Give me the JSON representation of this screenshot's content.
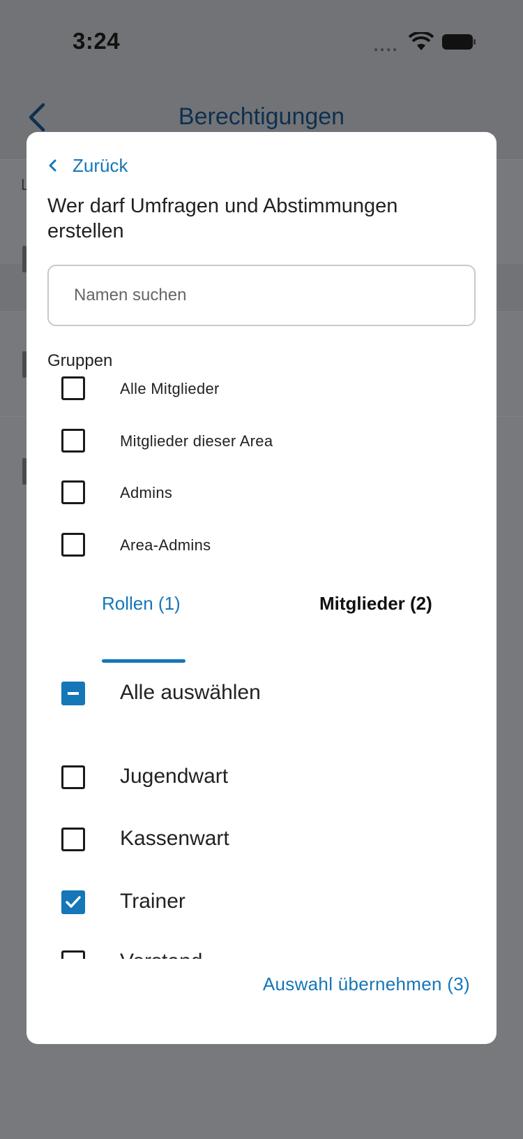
{
  "status_bar": {
    "time": "3:24"
  },
  "nav": {
    "title": "Berechtigungen",
    "bg_letter": "L"
  },
  "modal": {
    "back_label": "Zurück",
    "title": "Wer darf Umfragen und Abstimmungen erstellen",
    "search": {
      "placeholder": "Namen suchen",
      "value": ""
    },
    "groups_label": "Gruppen",
    "groups": [
      {
        "label": "Alle Mitglieder",
        "checked": false
      },
      {
        "label": "Mitglieder dieser Area",
        "checked": false
      },
      {
        "label": "Admins",
        "checked": false
      },
      {
        "label": "Area-Admins",
        "checked": false
      }
    ],
    "tabs": [
      {
        "label": "Rollen (1)",
        "active": true
      },
      {
        "label": "Mitglieder (2)",
        "active": false
      }
    ],
    "select_all": {
      "label": "Alle auswählen",
      "state": "partial"
    },
    "roles": [
      {
        "label": "Jugendwart",
        "checked": false
      },
      {
        "label": "Kassenwart",
        "checked": false
      },
      {
        "label": "Trainer",
        "checked": true
      },
      {
        "label": "Vorstand",
        "checked": false
      }
    ],
    "apply_label": "Auswahl übernehmen (3)"
  },
  "colors": {
    "accent": "#1576b8",
    "overlay": "#727376",
    "title_navy": "#0e3050"
  }
}
